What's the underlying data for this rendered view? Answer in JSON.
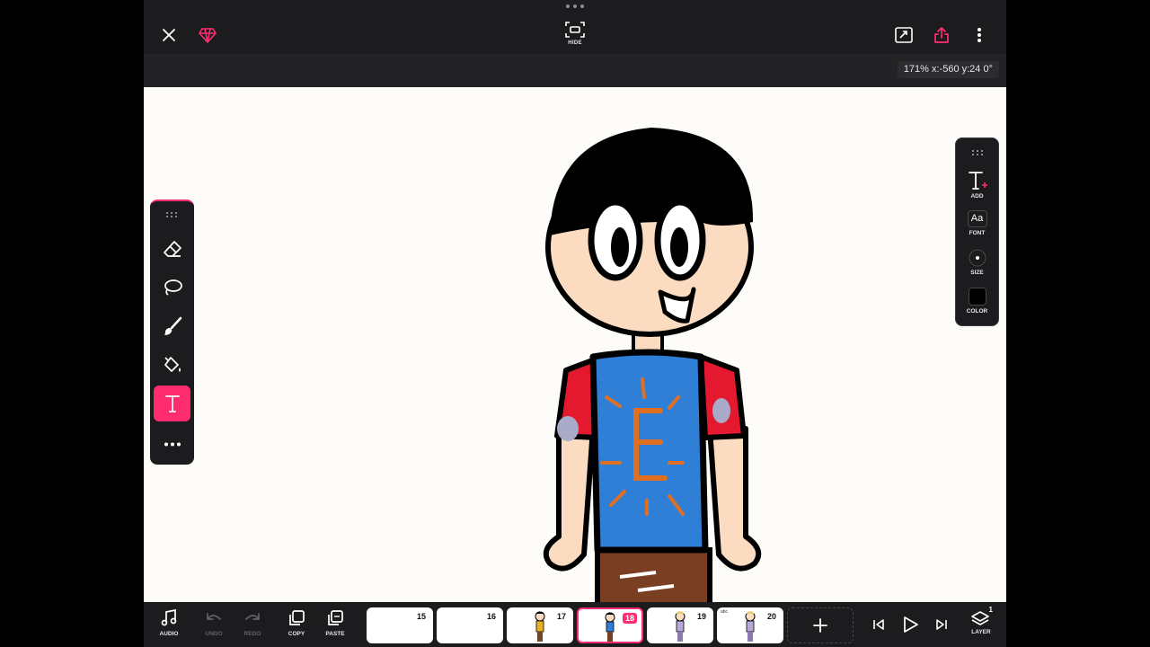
{
  "toolbar": {
    "hide_label": "HIDE",
    "zoom_readout": "171% x:-560 y:24 0°"
  },
  "text_panel": {
    "add_label": "ADD",
    "font_label": "FONT",
    "font_glyph": "Aa",
    "size_label": "SIZE",
    "color_label": "COLOR",
    "current_color": "#000000"
  },
  "bottom": {
    "audio_label": "AUDIO",
    "undo_label": "UNDO",
    "redo_label": "REDO",
    "copy_label": "COPY",
    "paste_label": "PASTE",
    "layer_label": "LAYER",
    "layer_count": "1",
    "frames": [
      {
        "number": "15",
        "active": false
      },
      {
        "number": "16",
        "active": false
      },
      {
        "number": "17",
        "active": false
      },
      {
        "number": "18",
        "active": true
      },
      {
        "number": "19",
        "active": false
      },
      {
        "number": "20",
        "active": false
      }
    ],
    "frame20_note": "abc"
  },
  "colors": {
    "accent": "#ff2d6f",
    "panel": "#1c1c1e",
    "canvas": "#fdfcf9"
  }
}
